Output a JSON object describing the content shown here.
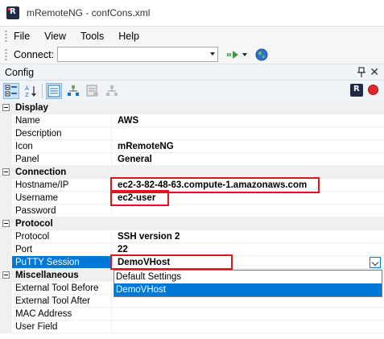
{
  "window": {
    "title": "mRemoteNG - confCons.xml"
  },
  "menu": {
    "items": [
      "File",
      "View",
      "Tools",
      "Help"
    ]
  },
  "toolbar": {
    "connect_label": "Connect:",
    "connect_value": ""
  },
  "panel": {
    "title": "Config"
  },
  "properties": {
    "display": {
      "label": "Display",
      "rows": [
        {
          "name": "Name",
          "value": "AWS"
        },
        {
          "name": "Description",
          "value": ""
        },
        {
          "name": "Icon",
          "value": "mRemoteNG"
        },
        {
          "name": "Panel",
          "value": "General"
        }
      ]
    },
    "connection": {
      "label": "Connection",
      "rows": [
        {
          "name": "Hostname/IP",
          "value": "ec2-3-82-48-63.compute-1.amazonaws.com"
        },
        {
          "name": "Username",
          "value": "ec2-user"
        },
        {
          "name": "Password",
          "value": ""
        }
      ]
    },
    "protocol": {
      "label": "Protocol",
      "rows": [
        {
          "name": "Protocol",
          "value": "SSH version 2"
        },
        {
          "name": "Port",
          "value": "22"
        },
        {
          "name": "PuTTY Session",
          "value": "DemoVHost"
        }
      ]
    },
    "misc": {
      "label": "Miscellaneous",
      "rows": [
        {
          "name": "External Tool Before",
          "value": ""
        },
        {
          "name": "External Tool After",
          "value": ""
        },
        {
          "name": "MAC Address",
          "value": ""
        },
        {
          "name": "User Field",
          "value": ""
        }
      ]
    }
  },
  "putty_dropdown": {
    "options": [
      "Default Settings",
      "DemoVHost"
    ],
    "selected": "DemoVHost"
  },
  "colors": {
    "selection": "#0078d7",
    "highlight_box": "#e0141c"
  }
}
